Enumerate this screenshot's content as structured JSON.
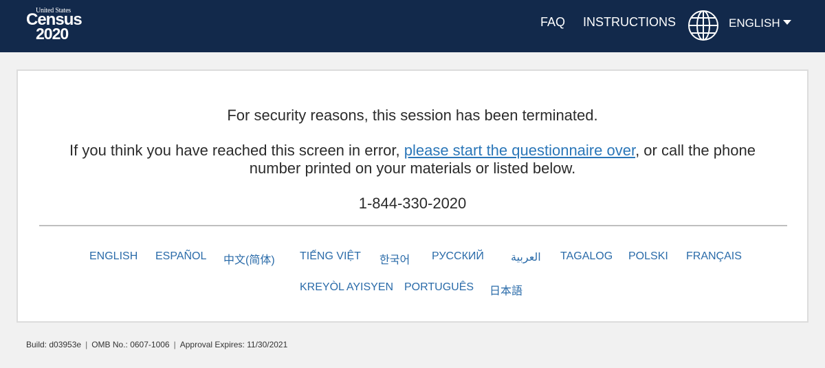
{
  "header": {
    "logo": {
      "line1": "United States",
      "line2": "Census",
      "line3": "2020"
    },
    "nav": {
      "faq": "FAQ",
      "instructions": "INSTRUCTIONS"
    },
    "globe_icon": "globe-icon",
    "language_selector": {
      "value": "ENGLISH",
      "icon": "caret-down-icon"
    }
  },
  "message": {
    "line1": "For security reasons, this session has been terminated.",
    "line2_before": "If you think you have reached this screen in error, ",
    "line2_link": "please start the questionnaire over",
    "line2_after": ", or call the phone number printed on your materials or listed below.",
    "phone": "1-844-330-2020"
  },
  "languages": [
    "ENGLISH",
    "ESPAÑOL",
    "中文(简体)",
    "TIẾNG VIỆT",
    "한국어",
    "РУССКИЙ",
    "العربية",
    "TAGALOG",
    "POLSKI",
    "FRANÇAIS",
    "KREYÒL AYISYEN",
    "PORTUGUÊS",
    "日本語"
  ],
  "footer": {
    "build": "Build: d03953e",
    "omb": "OMB No.: 0607-1006",
    "approval": "Approval Expires: 11/30/2021",
    "separator": "|"
  },
  "colors": {
    "header_bg": "#12294b",
    "link": "#2a76b8",
    "page_bg": "#f1f1f1"
  }
}
